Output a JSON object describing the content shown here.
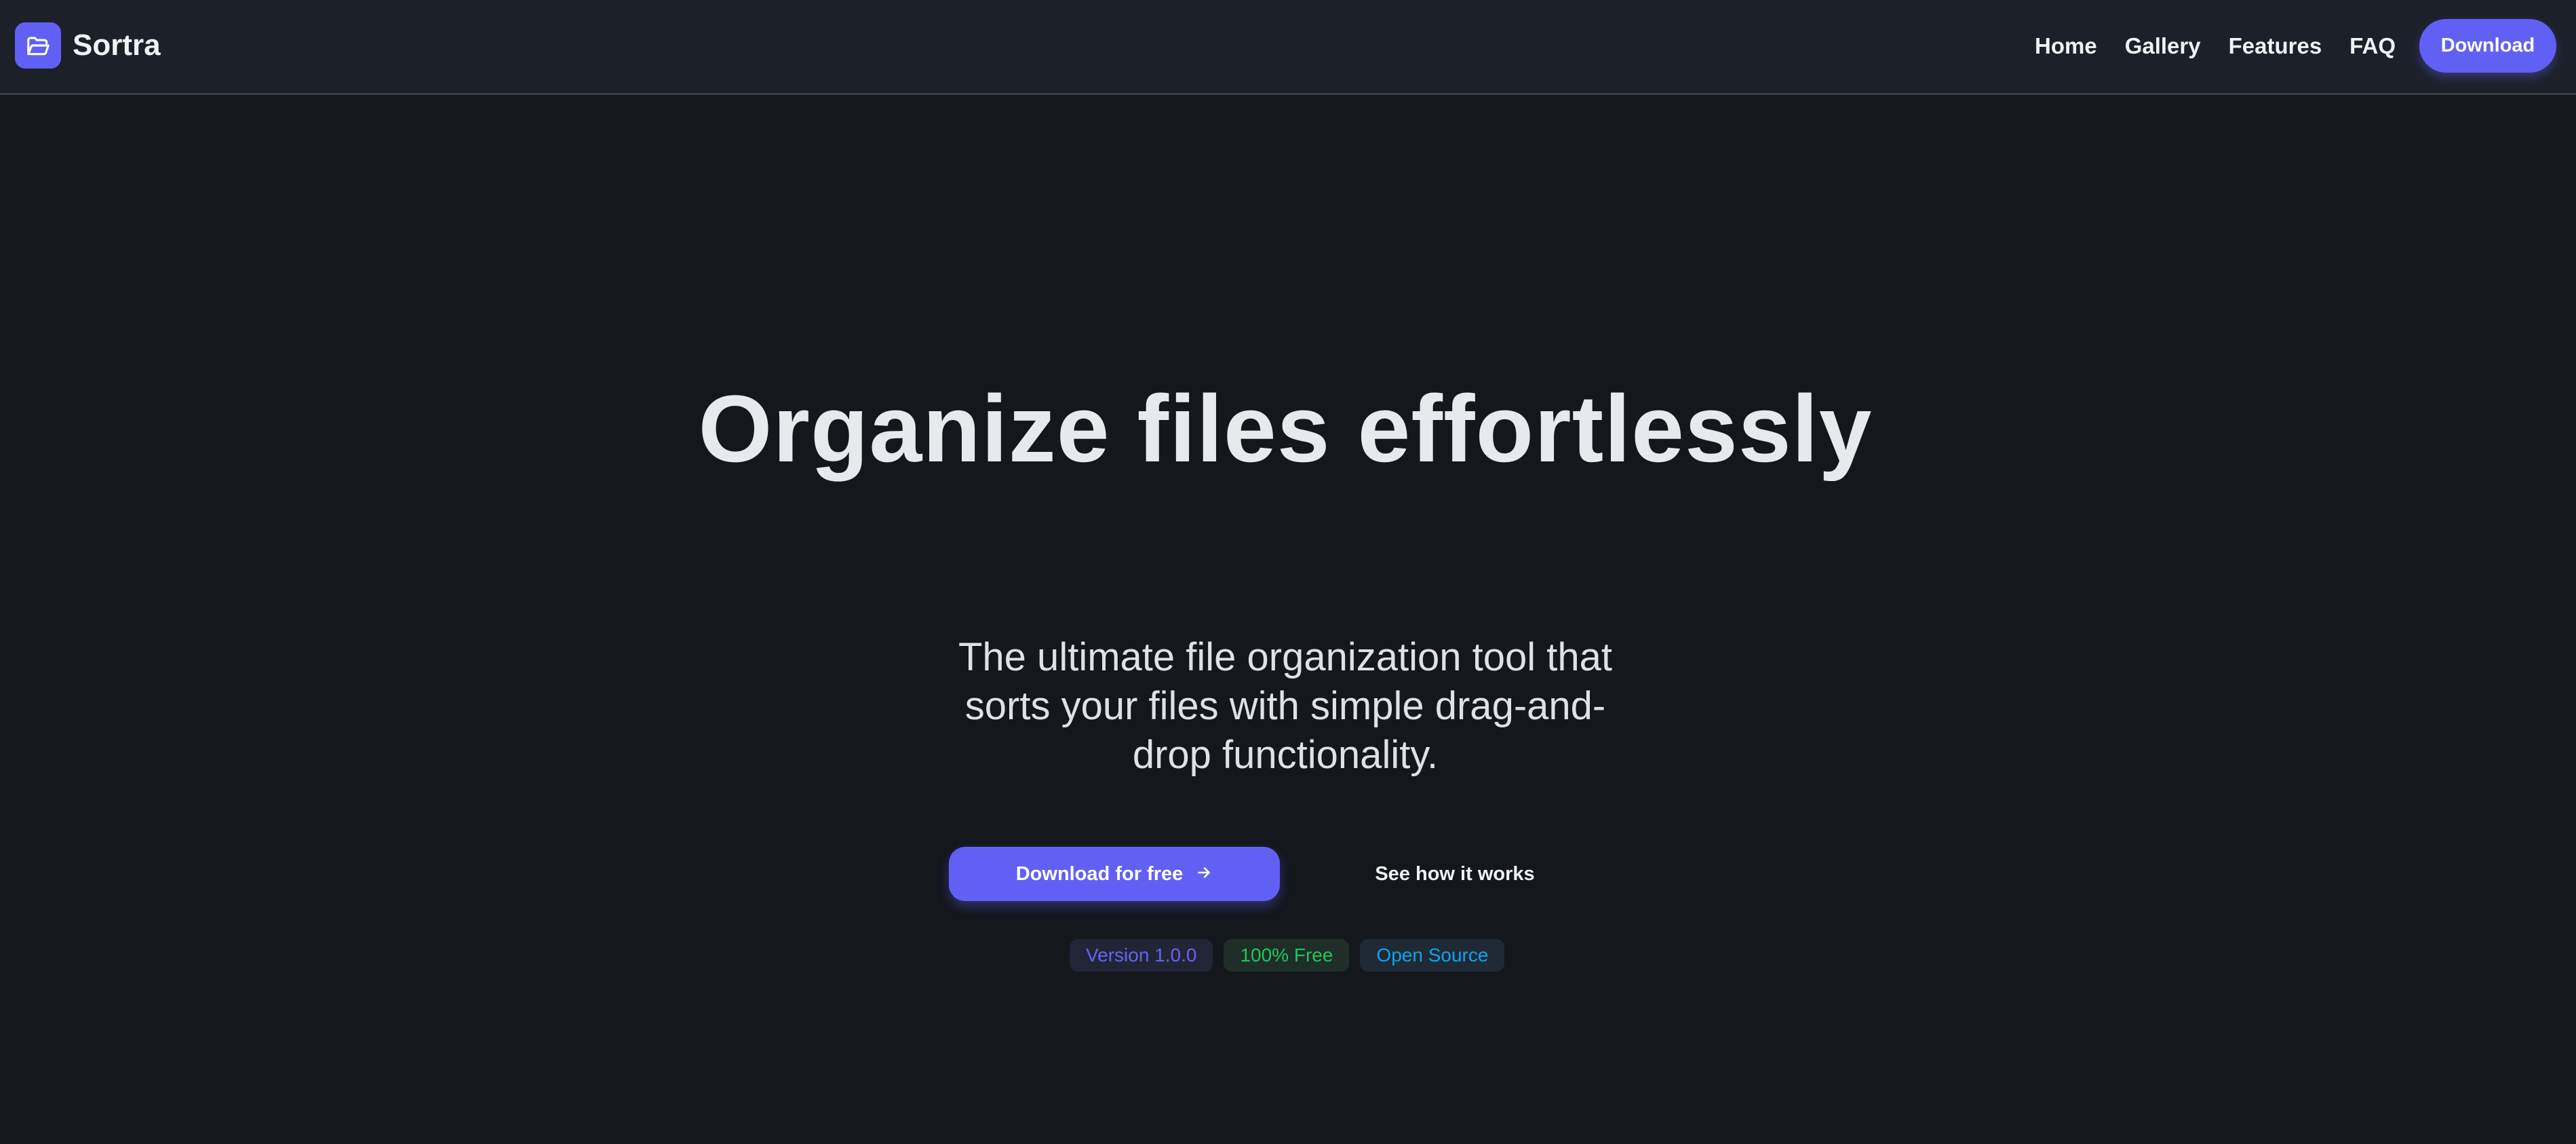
{
  "header": {
    "brand_name": "Sortra",
    "logo_icon": "folder-open-icon",
    "nav_items": [
      {
        "label": "Home"
      },
      {
        "label": "Gallery"
      },
      {
        "label": "Features"
      },
      {
        "label": "FAQ"
      }
    ],
    "download_label": "Download"
  },
  "hero": {
    "title": "Organize files effortlessly",
    "subtitle": "The ultimate file organization tool that sorts your files with simple drag-and-drop functionality.",
    "primary_cta": "Download for free",
    "primary_cta_icon": "arrow-right-icon",
    "secondary_cta": "See how it works"
  },
  "badges": [
    {
      "label": "Version 1.0.0",
      "text_color": "#6366f1",
      "bg_color": "#222536"
    },
    {
      "label": "100% Free",
      "text_color": "#22c55e",
      "bg_color": "#1f2e28"
    },
    {
      "label": "Open Source",
      "text_color": "#0ea5e9",
      "bg_color": "#1f2a36"
    }
  ],
  "colors": {
    "accent": "#6160f5",
    "background": "#14171c",
    "navbar": "#1c2129"
  }
}
